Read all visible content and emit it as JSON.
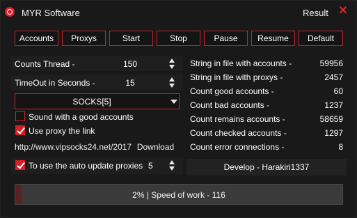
{
  "window": {
    "title": "MYR Software",
    "result_label": "Result",
    "close_icon": "close-icon",
    "accent_color": "#d41f28"
  },
  "toolbar": {
    "buttons": [
      {
        "id": "accounts",
        "label": "Accounts"
      },
      {
        "id": "proxys",
        "label": "Proxys"
      },
      {
        "id": "start",
        "label": "Start"
      },
      {
        "id": "stop",
        "label": "Stop"
      },
      {
        "id": "pause",
        "label": "Pause"
      },
      {
        "id": "resume",
        "label": "Resume"
      },
      {
        "id": "default",
        "label": "Default"
      }
    ]
  },
  "settings": {
    "threads": {
      "label": "Counts Thread -",
      "value": "150"
    },
    "timeout": {
      "label": "TimeOut in Seconds -",
      "value": "15"
    },
    "proxy_type": {
      "selected": "SOCKS[5]"
    },
    "sound": {
      "label": "Sound with a good accounts",
      "checked": false
    },
    "use_proxy_link": {
      "label": "Use proxy the link",
      "checked": true
    },
    "proxy_link": {
      "value": "http://www.vipsocks24.net/2017."
    },
    "download_label": "Download",
    "auto_update": {
      "label": "To use the auto update proxies",
      "checked": true,
      "value": "5"
    }
  },
  "stats": [
    {
      "label": "String in file with accounts -",
      "value": "59956"
    },
    {
      "label": "String in file with proxys -",
      "value": "2457"
    },
    {
      "label": "Count good accounts -",
      "value": "60"
    },
    {
      "label": "Count bad accounts -",
      "value": "1237"
    },
    {
      "label": "Count remains accounts -",
      "value": "58659"
    },
    {
      "label": "Count checked accounts -",
      "value": "1297"
    },
    {
      "label": "Count error connections -",
      "value": "8"
    }
  ],
  "developer": "Develop - Harakiri1337",
  "progress": {
    "text": "2% | Speed of work - 116",
    "percent": 2
  }
}
